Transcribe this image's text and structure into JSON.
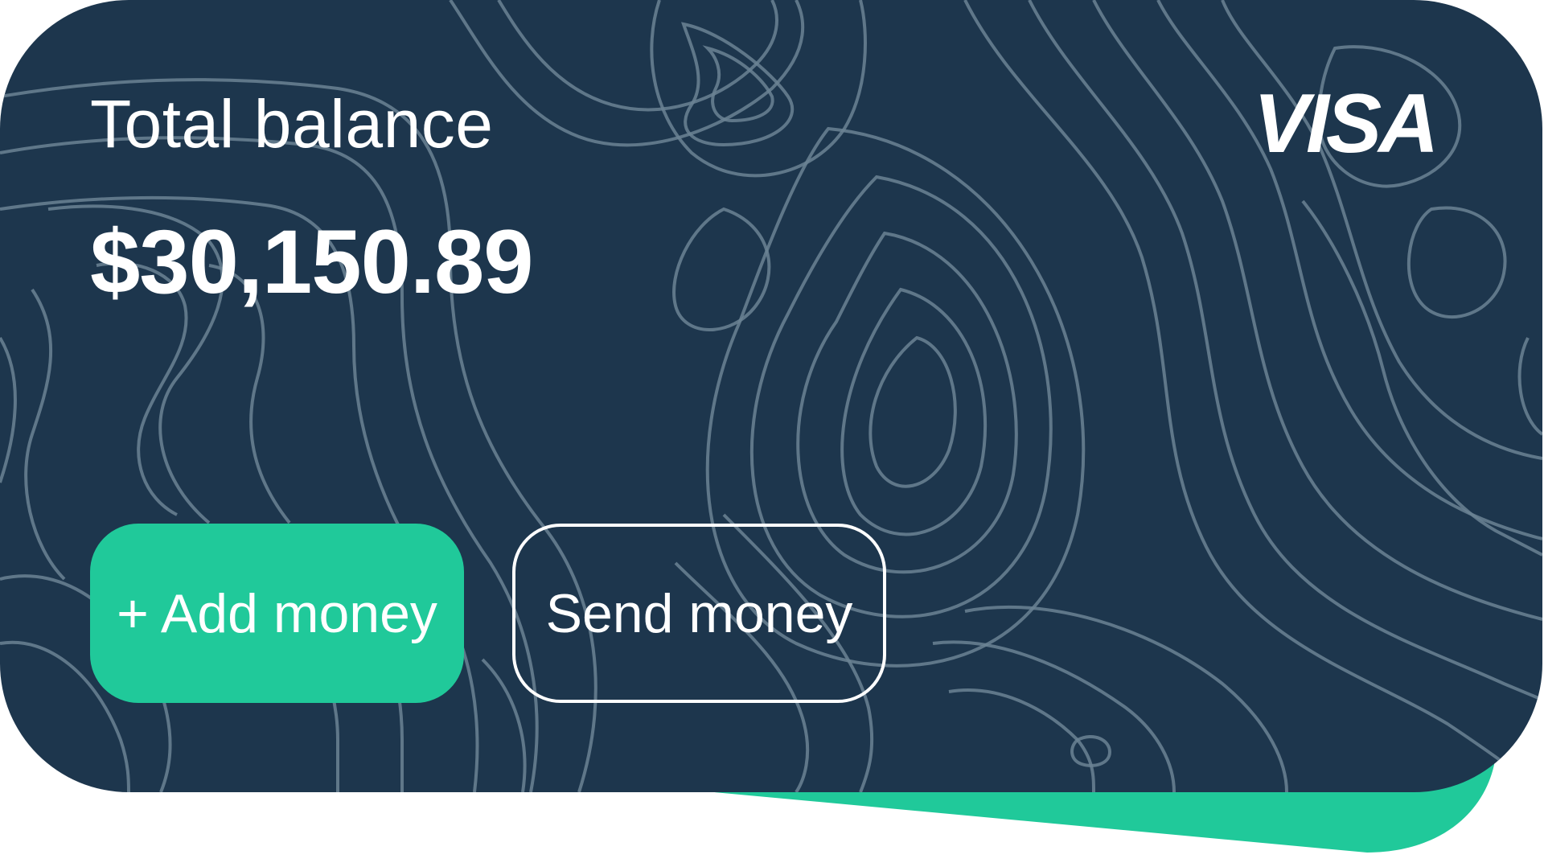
{
  "card": {
    "label": "Total balance",
    "amount": "$30,150.89",
    "brand": "VISA",
    "brand_icon": "visa-logo-icon",
    "background_color": "#1d364d",
    "accent_color": "#20c99a"
  },
  "actions": {
    "add_label": "+ Add money",
    "send_label": "Send money"
  }
}
